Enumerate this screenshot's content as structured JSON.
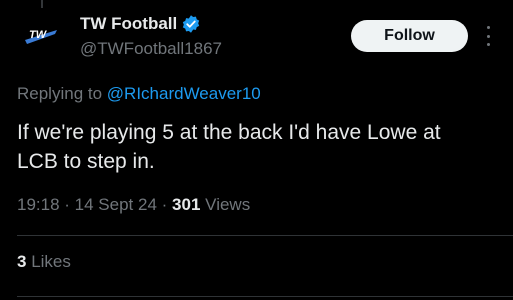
{
  "tweet": {
    "author": {
      "name": "TW Football",
      "handle": "@TWFootball1867",
      "verified": true,
      "avatar_text": "TW"
    },
    "follow_label": "Follow",
    "more_icon": "more-vertical-icon",
    "replying_prefix": "Replying to ",
    "replying_to": "@RIchardWeaver10",
    "text": "If we're playing 5 at the back I'd have Lowe at LCB to step in.",
    "time": "19:18",
    "date": "14 Sept 24",
    "views_count": "301",
    "views_label": "Views",
    "likes_count": "3",
    "likes_label": "Likes"
  },
  "colors": {
    "background": "#000000",
    "text": "#e7e9ea",
    "muted": "#71767b",
    "accent": "#1d9bf0",
    "verified": "#1d9bf0",
    "follow_bg": "#eff3f4"
  }
}
